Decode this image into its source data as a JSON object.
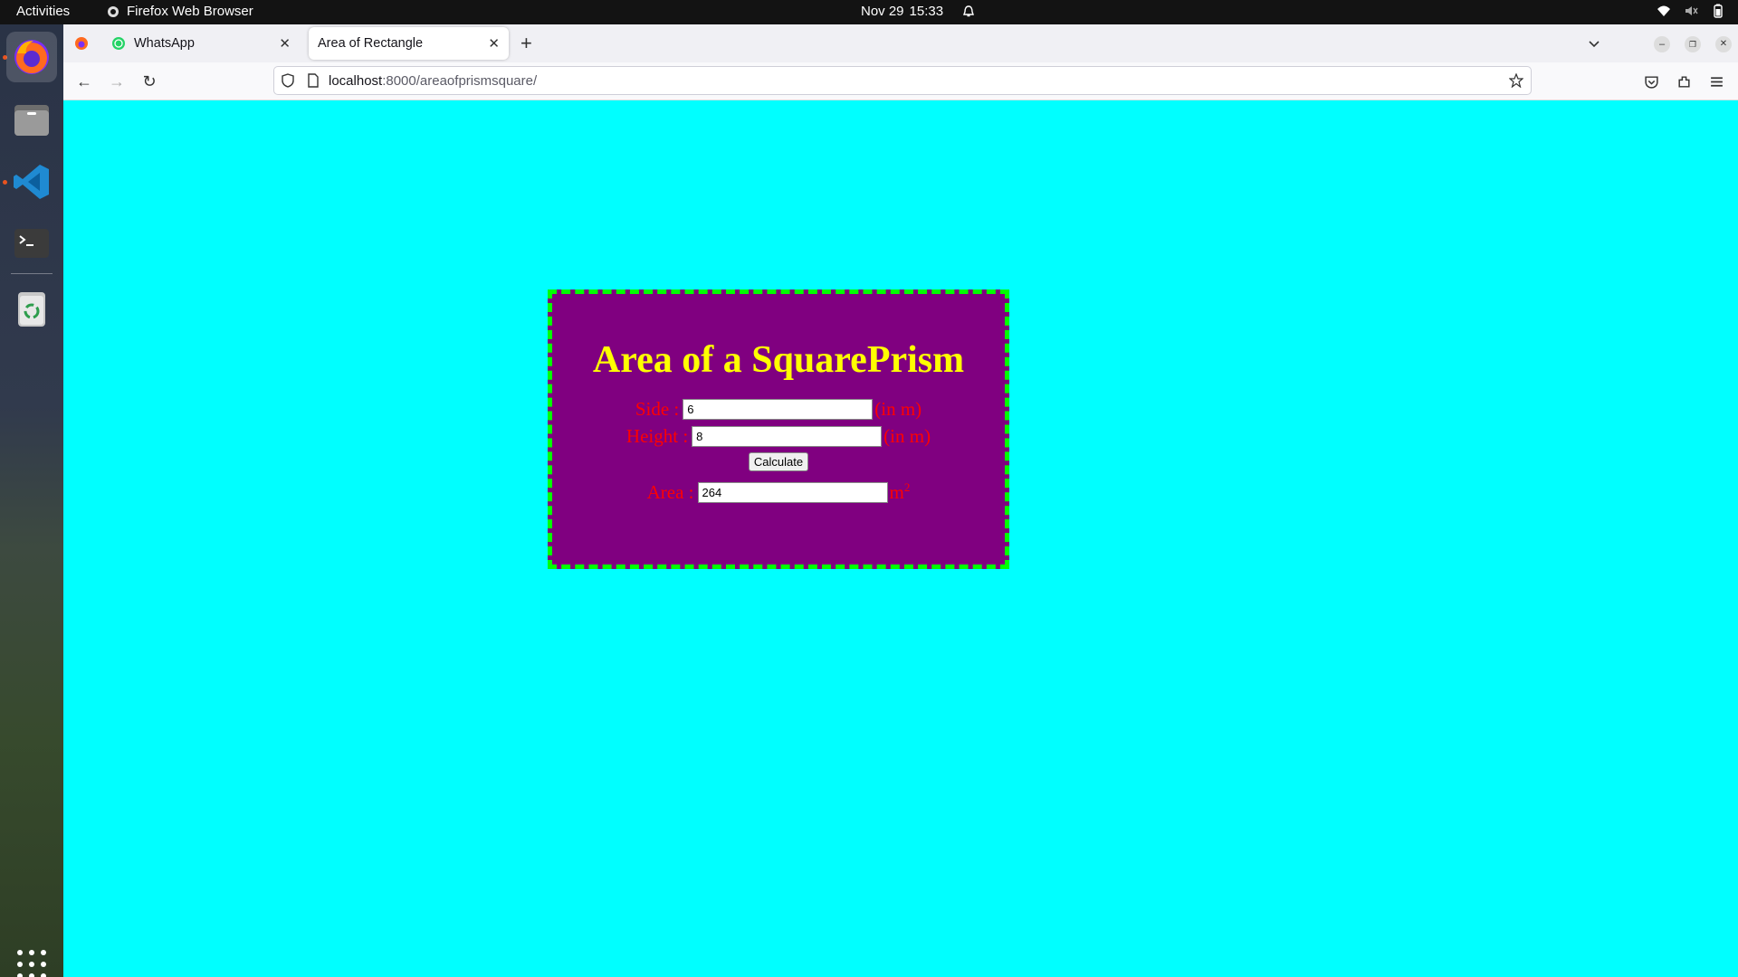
{
  "system": {
    "activities": "Activities",
    "app_name": "Firefox Web Browser",
    "date": "Nov 29",
    "time": "15:33"
  },
  "browser": {
    "tabs": [
      {
        "label": "WhatsApp"
      },
      {
        "label": "Area of Rectangle"
      }
    ],
    "url_host": "localhost",
    "url_path": ":8000/areaofprismsquare/"
  },
  "page": {
    "title": "Area of a SquarePrism",
    "side_label": "Side :",
    "side_value": "6",
    "side_unit": "(in m)",
    "height_label": "Height :",
    "height_value": "8",
    "height_unit": "(in m)",
    "calculate_label": "Calculate",
    "area_label": "Area :",
    "area_value": "264",
    "area_unit": "m",
    "area_exp": "2"
  },
  "colors": {
    "page_bg": "#00ffff",
    "card_bg": "#800080",
    "card_border": "#00ff00",
    "title": "#ffff00",
    "labels": "#ff0000"
  }
}
